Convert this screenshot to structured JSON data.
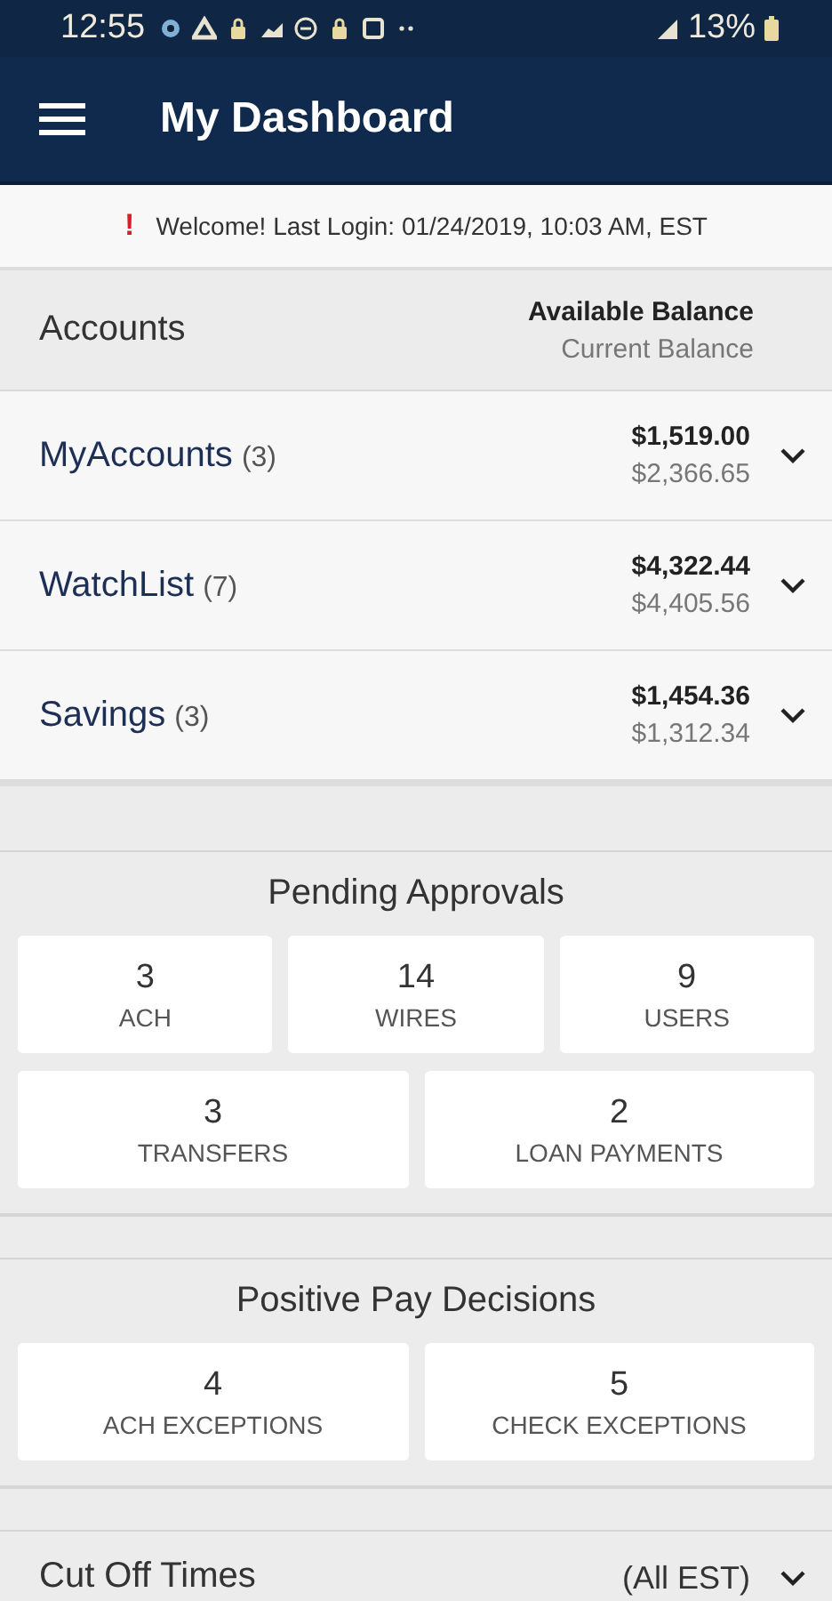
{
  "status_bar": {
    "time": "12:55",
    "battery": "13%"
  },
  "app_bar": {
    "title": "My Dashboard"
  },
  "banner": {
    "icon": "!",
    "text": "Welcome! Last Login: 01/24/2019, 10:03 AM, EST"
  },
  "accounts": {
    "title": "Accounts",
    "available_label": "Available Balance",
    "current_label": "Current Balance",
    "groups": [
      {
        "name": "MyAccounts",
        "count": "(3)",
        "available": "$1,519.00",
        "current": "$2,366.65",
        "expanded": false
      },
      {
        "name": "WatchList",
        "count": "(7)",
        "available": "$4,322.44",
        "current": "$4,405.56",
        "expanded": false
      },
      {
        "name": "Savings",
        "count": "(3)",
        "available": "$1,454.36",
        "current": "$1,312.34",
        "expanded": false
      }
    ]
  },
  "pending_approvals": {
    "title": "Pending Approvals",
    "tile_groups": [
      {
        "tiles": [
          {
            "count": "3",
            "label": "ACH"
          },
          {
            "count": "14",
            "label": "WIRES"
          },
          {
            "count": "9",
            "label": "USERS"
          }
        ]
      },
      {
        "tiles": [
          {
            "count": "3",
            "label": "TRANSFERS"
          },
          {
            "count": "2",
            "label": "LOAN PAYMENTS"
          }
        ]
      }
    ]
  },
  "positive_pay": {
    "title": "Positive Pay Decisions",
    "tile_groups": [
      {
        "tiles": [
          {
            "count": "4",
            "label": "ACH EXCEPTIONS"
          },
          {
            "count": "5",
            "label": "CHECK EXCEPTIONS"
          }
        ]
      }
    ]
  },
  "cut_off": {
    "title": "Cut Off Times",
    "note": "(All EST)",
    "expanded": false
  }
}
